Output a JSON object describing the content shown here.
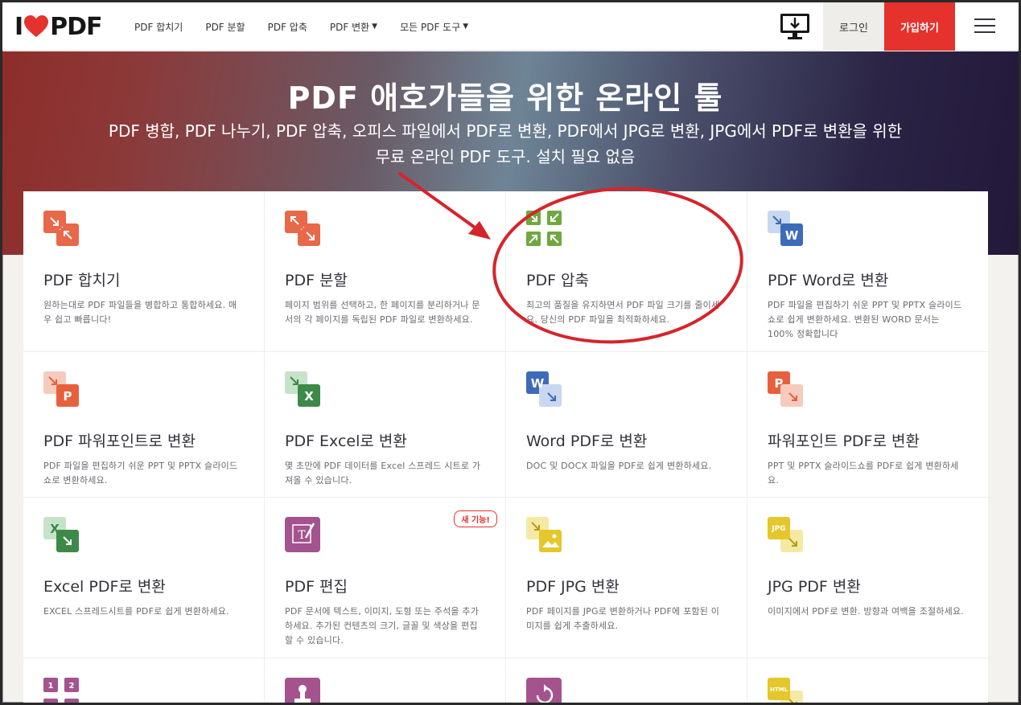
{
  "brand": {
    "logo_left": "I",
    "logo_right": "PDF",
    "accent": "#e5322d"
  },
  "nav": {
    "items": [
      {
        "label": "PDF 합치기",
        "caret": false
      },
      {
        "label": "PDF 분할",
        "caret": false
      },
      {
        "label": "PDF 압축",
        "caret": false
      },
      {
        "label": "PDF 변환",
        "caret": true
      },
      {
        "label": "모든 PDF 도구",
        "caret": true
      }
    ],
    "login": "로그인",
    "signup": "가입하기"
  },
  "hero": {
    "title": "PDF 애호가들을 위한 온라인 툴",
    "subtitle": "PDF 병합, PDF 나누기, PDF 압축, 오피스 파일에서 PDF로 변환, PDF에서 JPG로 변환, JPG에서 PDF로 변환을 위한 무료 온라인 PDF 도구. 설치 필요 없음"
  },
  "tools": [
    {
      "name": "merge",
      "title": "PDF 합치기",
      "desc": "원하는대로 PDF 파일들을 병합하고 통합하세요. 매우 쉽고 빠릅니다!",
      "icon": "merge-icon",
      "color": "#e8684a"
    },
    {
      "name": "split",
      "title": "PDF 분할",
      "desc": "페이지 범위를 선택하고, 한 페이지를 분리하거나 문서의 각 페이지를 독립된 PDF 파일로 변환하세요.",
      "icon": "split-icon",
      "color": "#e8684a"
    },
    {
      "name": "compress",
      "title": "PDF 압축",
      "desc": "최고의 품질을 유지하면서 PDF 파일 크기를 줄이세요. 당신의 PDF 파일을 최적화하세요.",
      "icon": "compress-icon",
      "color": "#6ea93f"
    },
    {
      "name": "pdf-to-word",
      "title": "PDF Word로 변환",
      "desc": "PDF 파일을 편집하기 쉬운 PPT 및 PPTX 슬라이드쇼로 쉽게 변환하세요. 변환된 WORD 문서는 100% 정확합니다",
      "icon": "word-icon",
      "color": "#3d6bb8"
    },
    {
      "name": "pdf-to-ppt",
      "title": "PDF 파워포인트로 변환",
      "desc": "PDF 파일을 편집하기 쉬운 PPT 및 PPTX 슬라이드쇼로 변환하세요.",
      "icon": "powerpoint-icon",
      "color": "#e7603e"
    },
    {
      "name": "pdf-to-excel",
      "title": "PDF Excel로 변환",
      "desc": "몇 초만에 PDF 데이터를 Excel 스프레드 시트로 가져올 수 있습니다.",
      "icon": "excel-icon",
      "color": "#3d8a48"
    },
    {
      "name": "word-to-pdf",
      "title": "Word PDF로 변환",
      "desc": "DOC 및 DOCX 파일을 PDF로 쉽게 변환하세요.",
      "icon": "word-icon",
      "color": "#3d6bb8"
    },
    {
      "name": "ppt-to-pdf",
      "title": "파워포인트 PDF로 변환",
      "desc": "PPT 및 PPTX 슬라이드쇼를 PDF로 쉽게 변환하세요.",
      "icon": "powerpoint-icon",
      "color": "#e7603e"
    },
    {
      "name": "excel-to-pdf",
      "title": "Excel PDF로 변환",
      "desc": "EXCEL 스프레드시트를 PDF로 쉽게 변환하세요.",
      "icon": "excel-icon",
      "color": "#3d8a48"
    },
    {
      "name": "edit-pdf",
      "title": "PDF 편집",
      "desc": "PDF 문서에 텍스트, 이미지, 도형 또는 주석을 추가하세요. 추가된 컨텐츠의 크기, 글꼴 및 색상을 편집할 수 있습니다.",
      "icon": "edit-icon",
      "color": "#a4538e",
      "badge": "새 기능!"
    },
    {
      "name": "pdf-to-jpg",
      "title": "PDF JPG 변환",
      "desc": "PDF 페이지를 JPG로 변환하거나 PDF에 포함된 이미지를 쉽게 추출하세요.",
      "icon": "image-icon",
      "color": "#e5c72c"
    },
    {
      "name": "jpg-to-pdf",
      "title": "JPG PDF 변환",
      "desc": "이미지에서 PDF로 변환. 방향과 여백을 조절하세요.",
      "icon": "jpg-icon",
      "color": "#e5c72c",
      "icon_label": "JPG"
    },
    {
      "name": "page-numbers",
      "title": "",
      "desc": "",
      "icon": "page-numbers-icon",
      "color": "#a4538e",
      "icon_label_a": "1",
      "icon_label_b": "2"
    },
    {
      "name": "sign",
      "title": "",
      "desc": "",
      "icon": "stamp-icon",
      "color": "#a4538e"
    },
    {
      "name": "rotate",
      "title": "",
      "desc": "",
      "icon": "rotate-icon",
      "color": "#a4538e"
    },
    {
      "name": "html-to-pdf",
      "title": "",
      "desc": "",
      "icon": "html-icon",
      "color": "#e5c72c",
      "icon_label": "HTML"
    }
  ],
  "annotation": {
    "color": "#d6242b"
  }
}
